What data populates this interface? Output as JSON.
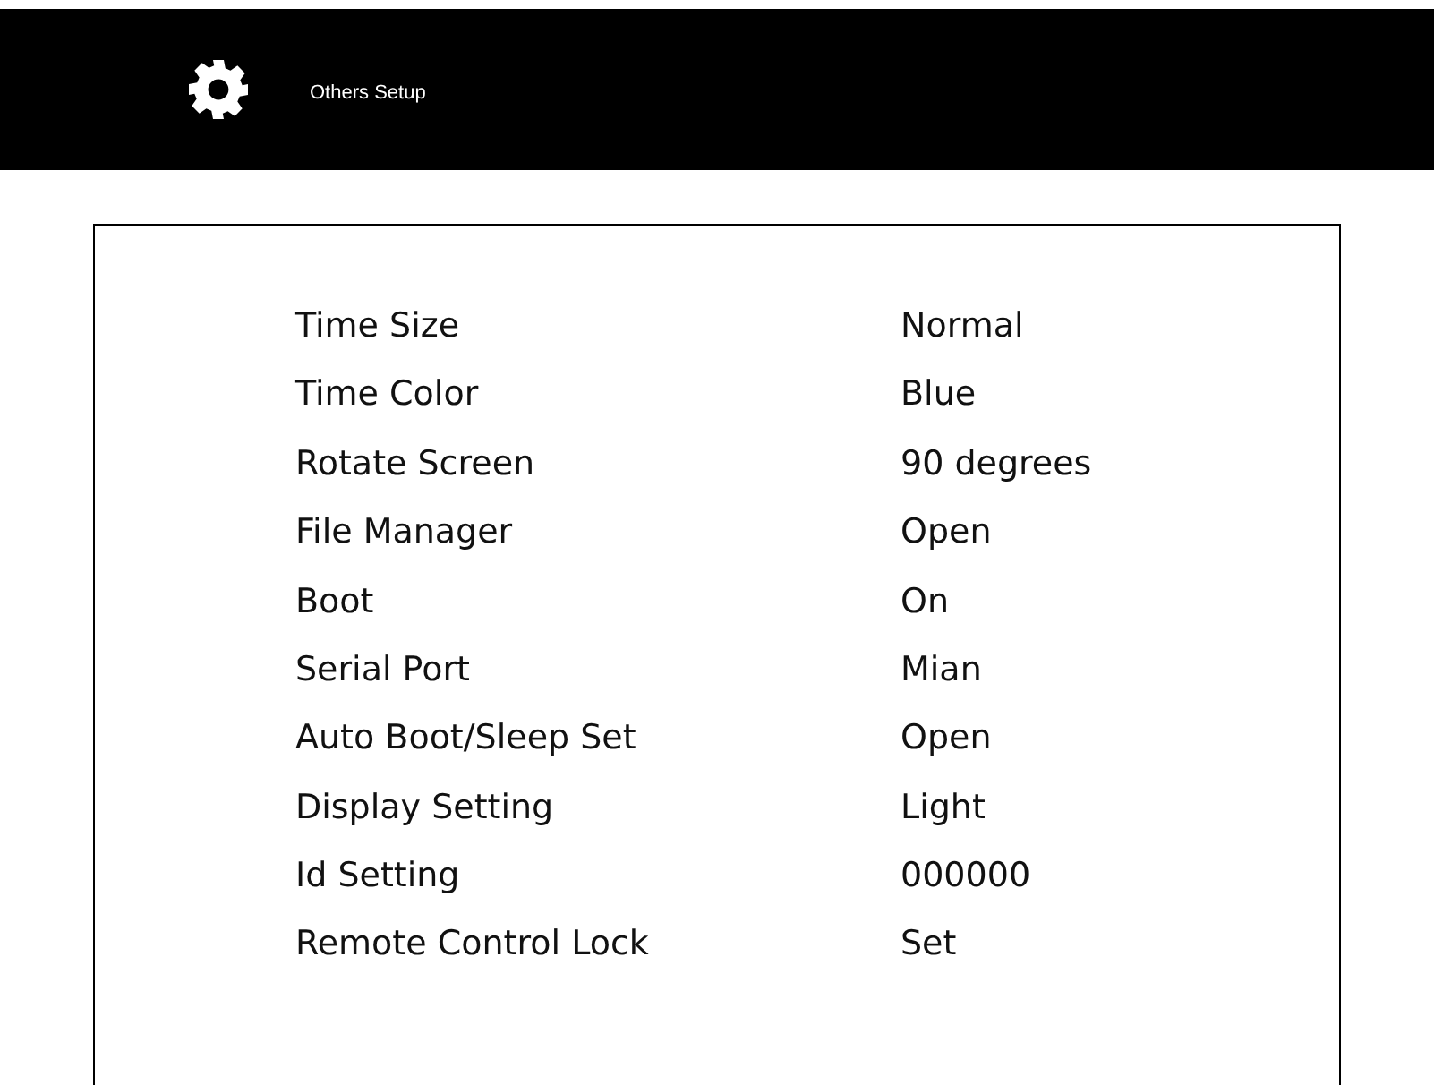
{
  "header": {
    "title": "Others Setup"
  },
  "settings": [
    {
      "label": "Time Size",
      "value": "Normal"
    },
    {
      "label": "Time Color",
      "value": "Blue"
    },
    {
      "label": "Rotate Screen",
      "value": "90 degrees"
    },
    {
      "label": "File Manager",
      "value": "Open"
    },
    {
      "label": "Boot",
      "value": "On"
    },
    {
      "label": "Serial Port",
      "value": "Mian"
    },
    {
      "label": "Auto Boot/Sleep Set",
      "value": "Open"
    },
    {
      "label": "Display Setting",
      "value": "Light"
    },
    {
      "label": "Id Setting",
      "value": "000000"
    },
    {
      "label": "Remote Control Lock",
      "value": "Set"
    }
  ]
}
